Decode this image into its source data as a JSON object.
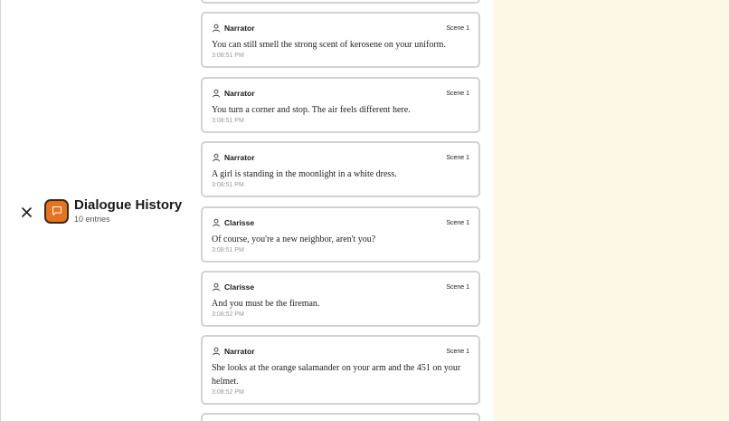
{
  "header": {
    "title": "Dialogue History",
    "count": "10 entries"
  },
  "entries": [
    {
      "speaker": "Narrator",
      "scene": "Scene 1",
      "text": "You can still smell the strong scent of kerosene on your uniform.",
      "time": "3:08:51 PM"
    },
    {
      "speaker": "Narrator",
      "scene": "Scene 1",
      "text": "You turn a corner and stop. The air feels different here.",
      "time": "3:08:51 PM"
    },
    {
      "speaker": "Narrator",
      "scene": "Scene 1",
      "text": "A girl is standing in the moonlight in a white dress.",
      "time": "3:08:51 PM"
    },
    {
      "speaker": "Clarisse",
      "scene": "Scene 1",
      "text": "Of course, you're a new neighbor, aren't you?",
      "time": "3:08:51 PM"
    },
    {
      "speaker": "Clarisse",
      "scene": "Scene 1",
      "text": "And you must be the fireman.",
      "time": "3:08:52 PM"
    },
    {
      "speaker": "Narrator",
      "scene": "Scene 1",
      "text": "She looks at the orange salamander on your arm and the 451 on your helmet.",
      "time": "3:08:52 PM"
    }
  ],
  "colors": {
    "accent": "#e8731e",
    "panel": "#fdf8e6",
    "card_border": "#d2d2d2"
  }
}
